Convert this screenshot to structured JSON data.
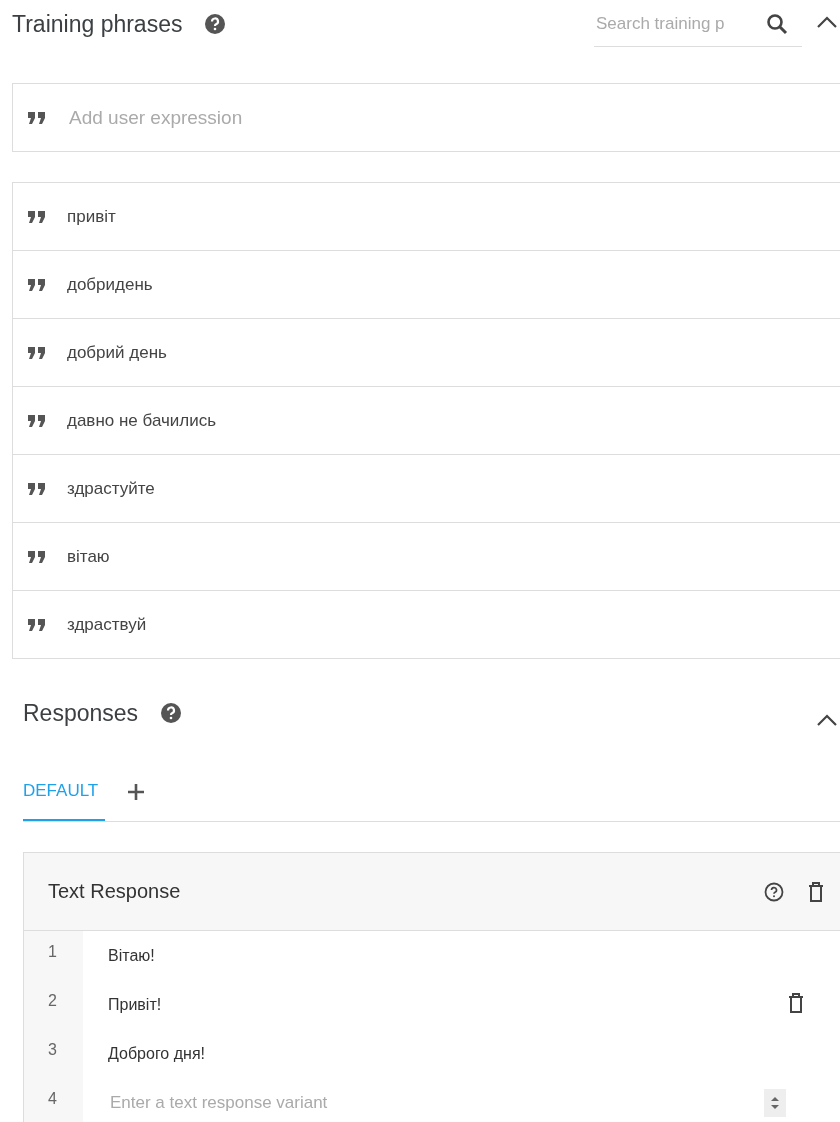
{
  "training": {
    "title": "Training phrases",
    "search": {
      "placeholder": "Search training p"
    },
    "expanded": true,
    "add": {
      "placeholder": "Add user expression"
    },
    "phrases": [
      "привіт",
      "добридень",
      "добрий день",
      "давно не бачились",
      "здрастуйте",
      "вітаю",
      "здраствуй"
    ]
  },
  "responses": {
    "title": "Responses",
    "expanded": true,
    "tabs": [
      {
        "label": "DEFAULT",
        "selected": true
      }
    ],
    "card": {
      "title": "Text Response",
      "rows": [
        {
          "kind": "text",
          "number": "1",
          "text": "Вітаю!",
          "show_delete": false
        },
        {
          "kind": "text",
          "number": "2",
          "text": "Привіт!",
          "show_delete": true
        },
        {
          "kind": "text",
          "number": "3",
          "text": "Доброго дня!",
          "show_delete": false
        },
        {
          "kind": "input",
          "number": "4",
          "placeholder": "Enter a text response variant",
          "show_delete": false
        }
      ]
    }
  }
}
